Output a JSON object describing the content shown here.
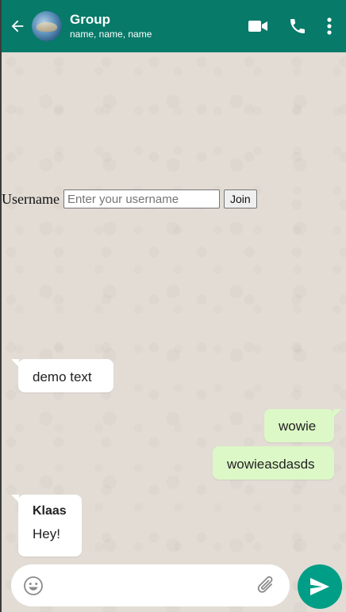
{
  "header": {
    "title": "Group",
    "subtitle": "name, name, name",
    "icons": [
      "back-arrow-icon",
      "video-call-icon",
      "phone-icon",
      "more-vertical-icon"
    ],
    "background_color": "#077a6a"
  },
  "join_form": {
    "label": "Username",
    "placeholder": "Enter your username",
    "value": "",
    "button_label": "Join"
  },
  "messages": [
    {
      "direction": "incoming",
      "sender": "",
      "text": "demo text"
    },
    {
      "direction": "outgoing",
      "sender": "",
      "text": "wowie"
    },
    {
      "direction": "outgoing",
      "sender": "",
      "text": "wowieasdasds"
    },
    {
      "direction": "incoming",
      "sender": "Klaas",
      "text": "Hey!"
    }
  ],
  "composer": {
    "placeholder": "",
    "value": "",
    "icons": [
      "emoji-icon",
      "attach-icon",
      "send-icon"
    ],
    "send_button_color": "#009e86"
  },
  "colors": {
    "incoming_bubble": "#ffffff",
    "outgoing_bubble": "#dcf8c6",
    "chat_background": "#e2dcd5"
  }
}
